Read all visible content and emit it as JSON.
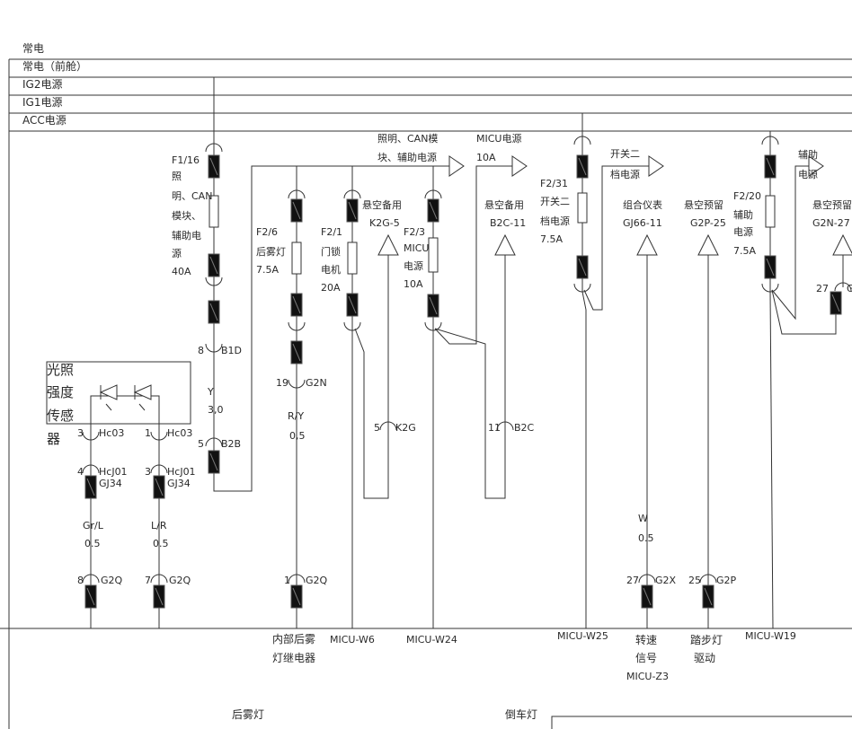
{
  "buses": [
    "常电",
    "常电（前舱）",
    "IG2电源",
    "IG1电源",
    "ACC电源"
  ],
  "fuses": {
    "f1_16": [
      "F1/16",
      "照",
      "明、CAN",
      "模块、",
      "辅助电",
      "源",
      "40A"
    ],
    "f2_6": [
      "F2/6",
      "后雾灯",
      "7.5A"
    ],
    "f2_1": [
      "F2/1",
      "门锁",
      "电机",
      "20A"
    ],
    "f2_3": [
      "F2/3",
      "MICU",
      "电源",
      "10A"
    ],
    "f2_31": [
      "F2/31",
      "开关二",
      "档电源",
      "7.5A"
    ],
    "f2_20": [
      "F2/20",
      "辅助",
      "电源",
      "7.5A"
    ]
  },
  "arrows": {
    "lighting": [
      "照明、CAN模",
      "块、辅助电源"
    ],
    "micu": [
      "MICU电源",
      "10A"
    ],
    "switch2": [
      "开关二",
      "档电源"
    ],
    "aux": [
      "辅助",
      "电源"
    ]
  },
  "spares": {
    "k2g": [
      "悬空备用",
      "K2G-5"
    ],
    "b2c": [
      "悬空备用",
      "B2C-11"
    ],
    "gj66": [
      "组合仪表",
      "GJ66-11"
    ],
    "g2p": [
      "悬空预留",
      "G2P-25"
    ],
    "g2n": [
      "悬空预留",
      "G2N-27"
    ]
  },
  "pins": {
    "b1d": [
      "8",
      "B1D"
    ],
    "b2b": [
      "5",
      "B2B"
    ],
    "g2n": [
      "19",
      "G2N"
    ],
    "k2g": [
      "5",
      "K2G"
    ],
    "b2c": [
      "11",
      "B2C"
    ],
    "hc03a": [
      "3",
      "Hc03"
    ],
    "hc03b": [
      "1",
      "Hc03"
    ],
    "hcj01a": [
      "4",
      "HcJ01",
      "GJ34"
    ],
    "hcj01b": [
      "3",
      "HcJ01",
      "GJ34"
    ],
    "g2qa": [
      "8",
      "G2Q"
    ],
    "g2qb": [
      "7",
      "G2Q"
    ],
    "g2q1": [
      "1",
      "G2Q"
    ],
    "g2x": [
      "27",
      "G2X"
    ],
    "g2p": [
      "25",
      "G2P"
    ],
    "g2n27": [
      "27",
      "G"
    ]
  },
  "wires": {
    "y30": [
      "Y",
      "3,0"
    ],
    "ry05": [
      "R/Y",
      "0,5"
    ],
    "grl05": [
      "Gr/L",
      "0.5"
    ],
    "lr05": [
      "L/R",
      "0.5"
    ],
    "w05": [
      "W",
      "0.5"
    ]
  },
  "sensor": [
    "光照",
    "强度",
    "传感",
    "器"
  ],
  "bottom": {
    "relay": [
      "内部后雾",
      "灯继电器"
    ],
    "w6": "MICU-W6",
    "w24": "MICU-W24",
    "w25": "MICU-W25",
    "speed": [
      "转速",
      "信号",
      "MICU-Z3"
    ],
    "step": [
      "踏步灯",
      "驱动"
    ],
    "w19": "MICU-W19"
  },
  "footer": {
    "fog": "后雾灯",
    "reverse": "倒车灯"
  },
  "colors": {
    "line": "#333333",
    "connector": "#111111"
  }
}
